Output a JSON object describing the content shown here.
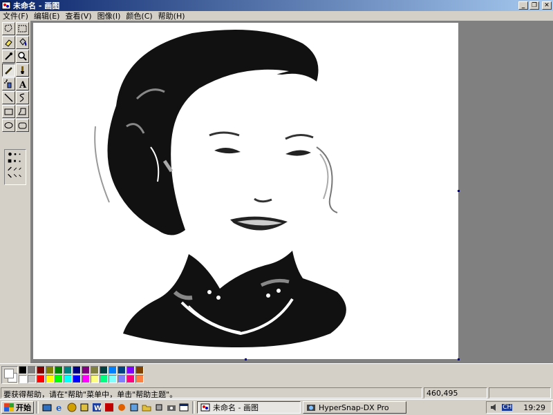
{
  "window": {
    "title": "未命名 - 画图"
  },
  "menu": [
    "文件(F)",
    "编辑(E)",
    "查看(V)",
    "图像(I)",
    "颜色(C)",
    "帮助(H)"
  ],
  "tools": [
    "free-select",
    "rect-select",
    "eraser",
    "fill",
    "color-picker",
    "magnifier",
    "pencil",
    "brush",
    "airbrush",
    "text",
    "line",
    "curve",
    "rectangle",
    "polygon",
    "ellipse",
    "rounded-rect"
  ],
  "palette": {
    "row1": [
      "#000000",
      "#808080",
      "#800000",
      "#808000",
      "#008000",
      "#008080",
      "#000080",
      "#800080",
      "#808040",
      "#004040",
      "#0080ff",
      "#004080",
      "#8000ff",
      "#804000"
    ],
    "row2": [
      "#ffffff",
      "#c0c0c0",
      "#ff0000",
      "#ffff00",
      "#00ff00",
      "#00ffff",
      "#0000ff",
      "#ff00ff",
      "#ffff80",
      "#00ff80",
      "#80ffff",
      "#8080ff",
      "#ff0080",
      "#ff8040"
    ]
  },
  "status": {
    "help": "要获得帮助，请在\"帮助\"菜单中，单击\"帮助主题\"。",
    "coords": "460,495"
  },
  "taskbar": {
    "start": "开始",
    "tasks": [
      {
        "label": "未命名 - 画图"
      },
      {
        "label": "HyperSnap-DX Pro"
      }
    ],
    "lang": "CH",
    "clock": "19:29"
  }
}
